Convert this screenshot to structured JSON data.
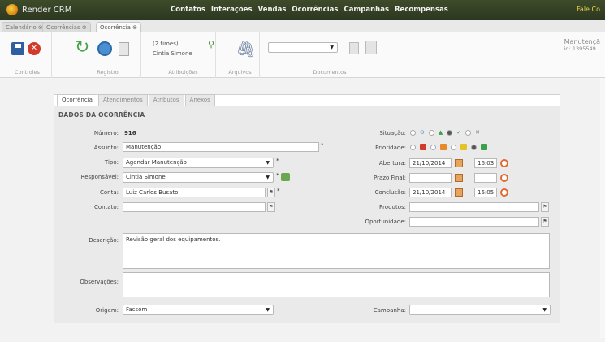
{
  "app": {
    "brand": "Render CRM",
    "user_link": "Fale Co"
  },
  "nav": [
    "Contatos",
    "Interações",
    "Vendas",
    "Ocorrências",
    "Campanhas",
    "Recompensas"
  ],
  "window_tabs": [
    "Calendário ⊗",
    "Ocorrências ⊗",
    "Ocorrência ⊗"
  ],
  "toolbar": {
    "groups": {
      "controles": "Controles",
      "registro": "Registro",
      "atribuicoes": "Atribuições",
      "arquivos": "Arquivos",
      "documentos": "Documentos"
    },
    "assign_count": "(2 times)",
    "assign_user": "Cintia Simone",
    "doc_select": ""
  },
  "right_info": {
    "title": "Manutençã",
    "id": "id: 1395549"
  },
  "inner_tabs": [
    "Ocorrência",
    "Atendimentos",
    "Atributos",
    "Anexos"
  ],
  "section_title": "DADOS DA OCORRÊNCIA",
  "form": {
    "numero_label": "Número:",
    "numero": "916",
    "assunto_label": "Assunto:",
    "assunto": "Manutenção",
    "tipo_label": "Tipo:",
    "tipo": "Agendar Manutenção",
    "responsavel_label": "Responsável:",
    "responsavel": "Cintia Simone",
    "conta_label": "Conta:",
    "conta": "Luiz Carlos Busato",
    "contato_label": "Contato:",
    "contato": "",
    "descricao_label": "Descrição:",
    "descricao": "Revisão geral dos equipamentos.",
    "observacoes_label": "Observações:",
    "observacoes": "",
    "origem_label": "Origem:",
    "origem": "Facsom",
    "situacao_label": "Situação:",
    "prioridade_label": "Prioridade:",
    "abertura_label": "Abertura:",
    "abertura_data": "21/10/2014",
    "abertura_hora": "16:03",
    "prazo_label": "Prazo Final:",
    "prazo_data": "",
    "prazo_hora": "",
    "conclusao_label": "Conclusão:",
    "conclusao_data": "21/10/2014",
    "conclusao_hora": "16:05",
    "produtos_label": "Produtos:",
    "produtos": "",
    "oportunidade_label": "Oportunidade:",
    "oportunidade": "",
    "campanha_label": "Campanha:",
    "campanha": ""
  },
  "colors": {
    "topbar": "#3e4b2a",
    "brand_accent": "#e8d64a",
    "priority_red": "#d23a2a",
    "priority_orange": "#e8892a",
    "priority_yellow": "#e6c22a",
    "priority_green": "#3aa04a"
  }
}
